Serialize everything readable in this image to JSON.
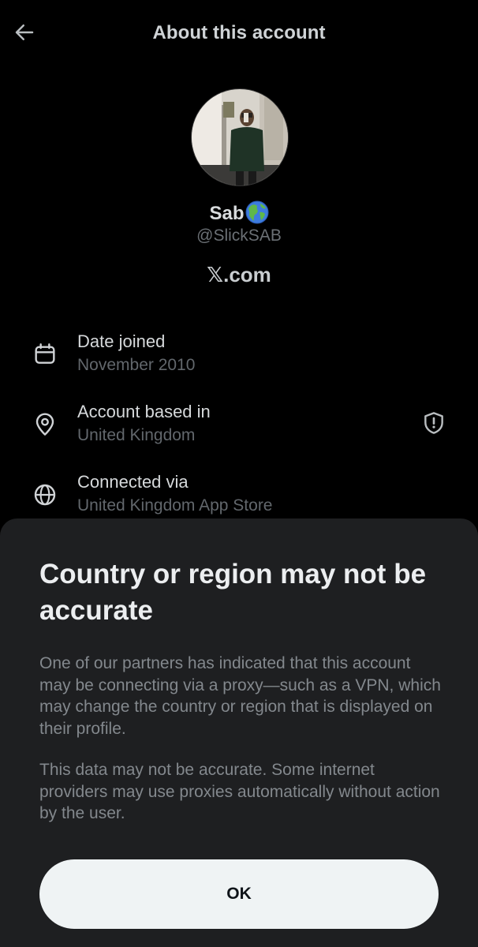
{
  "header": {
    "title": "About this account",
    "back_icon": "arrow-left-icon"
  },
  "profile": {
    "display_name": "Sab",
    "name_emoji": "globe-europe-africa-emoji",
    "handle": "@SlickSAB",
    "site": "𝕏.com"
  },
  "details": [
    {
      "icon": "calendar-icon",
      "label": "Date joined",
      "value": "November 2010"
    },
    {
      "icon": "location-pin-icon",
      "label": "Account based in",
      "value": "United Kingdom",
      "action_icon": "shield-alert-icon"
    },
    {
      "icon": "globe-icon",
      "label": "Connected via",
      "value": "United Kingdom App Store"
    }
  ],
  "sheet": {
    "title": "Country or region may not be accurate",
    "paragraph1": "One of our partners has indicated that this account may be connecting via a proxy—such as a VPN, which may change the country or region that is displayed on their profile.",
    "paragraph2": "This data may not be accurate. Some internet providers may use proxies automatically without action by the user.",
    "ok_label": "OK"
  },
  "colors": {
    "background": "#000000",
    "sheet_background": "#1e1f21",
    "button_background": "#eff3f4",
    "muted_text": "#62676c"
  }
}
